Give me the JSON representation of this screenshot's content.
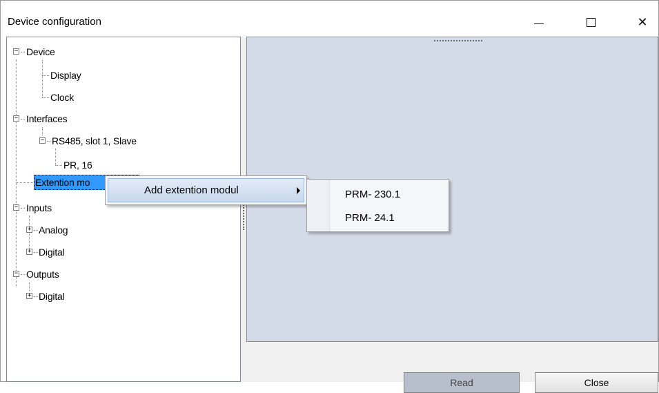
{
  "window": {
    "title": "Device configuration"
  },
  "tree": {
    "nodes": [
      {
        "label": "Device"
      },
      {
        "label": "Display"
      },
      {
        "label": "Clock"
      },
      {
        "label": "Interfaces"
      },
      {
        "label": "RS485, slot 1, Slave"
      },
      {
        "label": "PR, 16"
      },
      {
        "label": "Extention mo"
      },
      {
        "label": "Inputs"
      },
      {
        "label": "Analog"
      },
      {
        "label": "Digital"
      },
      {
        "label": "Outputs"
      },
      {
        "label": "Digital"
      }
    ],
    "collapse_glyph": "−",
    "expand_glyph": "+"
  },
  "context_menu": {
    "item_label": "Add extention modul"
  },
  "submenu": {
    "items": [
      {
        "label": "PRM- 230.1"
      },
      {
        "label": "PRM- 24.1"
      }
    ]
  },
  "buttons": {
    "read": "Read",
    "close": "Close"
  },
  "colors": {
    "selection": "#3399ff",
    "panel_background": "#d4dbe8",
    "menu_highlight": "#c8d8ee"
  },
  "icons": {
    "minimize": "minimize-icon",
    "maximize": "maximize-icon",
    "close": "close-icon",
    "submenu_arrow": "chevron-right-icon"
  }
}
